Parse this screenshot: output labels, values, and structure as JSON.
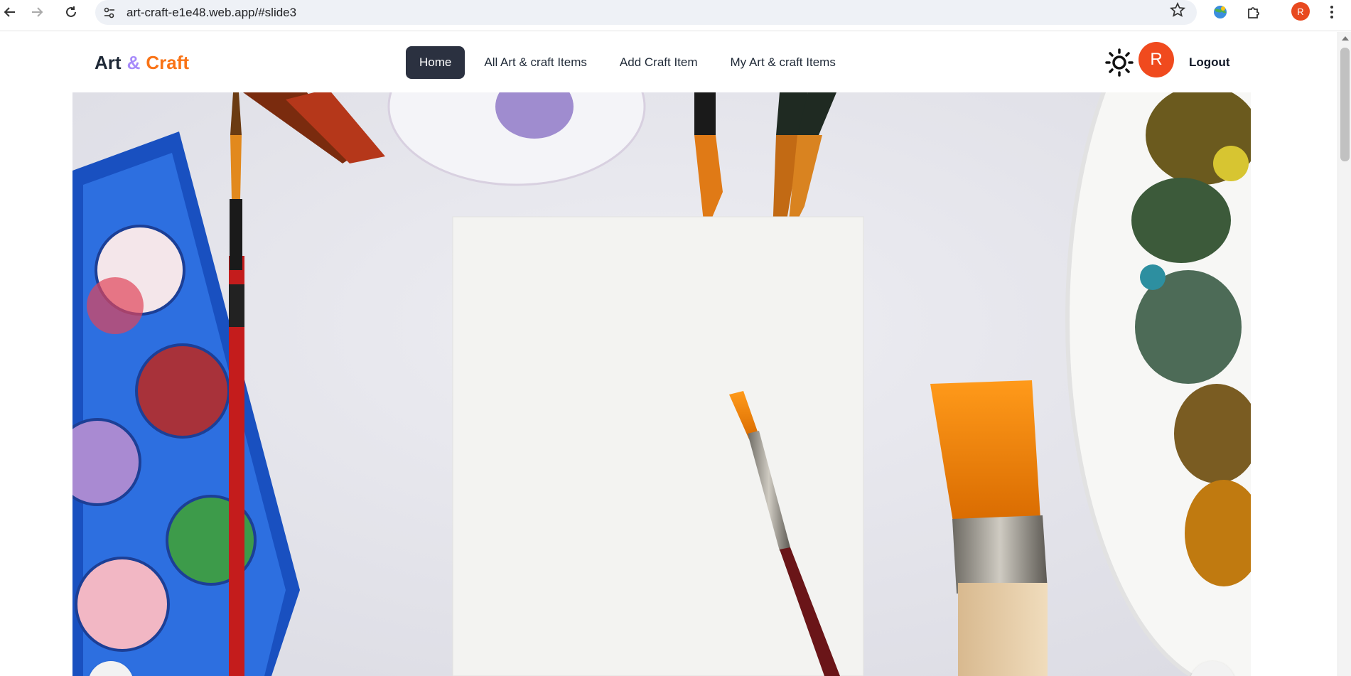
{
  "browser": {
    "url": "art-craft-e1e48.web.app/#slide3",
    "profile_initial": "R",
    "icons": [
      "back-arrow-icon",
      "forward-arrow-icon",
      "reload-icon",
      "site-settings-icon",
      "bookmark-star-icon",
      "extension-globe-icon",
      "extensions-puzzle-icon",
      "menu-kebab-icon"
    ]
  },
  "navbar": {
    "logo": {
      "part1": "Art",
      "amp": "&",
      "part2": "Craft"
    },
    "menu": [
      {
        "label": "Home",
        "active": true
      },
      {
        "label": "All Art & craft Items",
        "active": false
      },
      {
        "label": "Add Craft Item",
        "active": false
      },
      {
        "label": "My Art & craft Items",
        "active": false
      }
    ],
    "theme_icon": "sun-icon",
    "user_initial": "R",
    "logout_label": "Logout"
  },
  "hero": {
    "slide_icons": [
      "prev-slide-button",
      "next-slide-button"
    ]
  },
  "colors": {
    "logo_text": "#1f2937",
    "logo_amp": "#a78bfa",
    "logo_craft": "#f97316",
    "active_nav_bg": "#2b3140",
    "avatar": "#f04a1e"
  }
}
